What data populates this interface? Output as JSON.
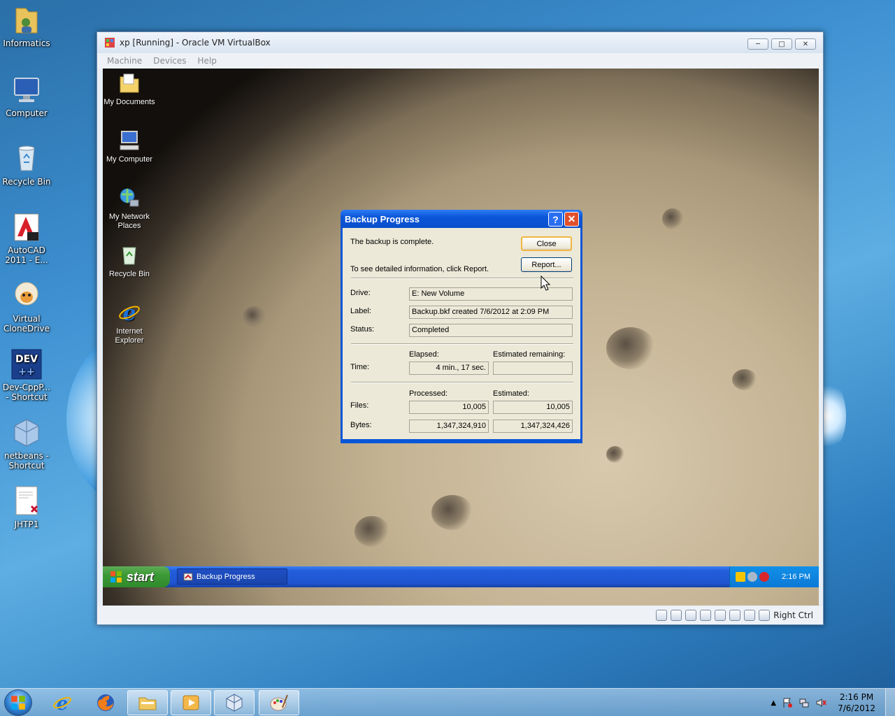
{
  "desktop_icons": [
    {
      "label": "Informatics",
      "icon": "folder-user-icon"
    },
    {
      "label": "Computer",
      "icon": "computer-icon"
    },
    {
      "label": "Recycle Bin",
      "icon": "recycle-bin-icon"
    },
    {
      "label": "AutoCAD 2011 - E...",
      "icon": "autocad-icon"
    },
    {
      "label": "Virtual CloneDrive",
      "icon": "sheep-icon"
    },
    {
      "label": "Dev-CppP... - Shortcut",
      "icon": "dev-cpp-icon"
    },
    {
      "label": "netbeans - Shortcut",
      "icon": "netbeans-icon"
    },
    {
      "label": "JHTP1",
      "icon": "pdf-document-icon"
    }
  ],
  "vbox": {
    "title": "xp [Running] - Oracle VM VirtualBox",
    "menu": [
      "Machine",
      "Devices",
      "Help"
    ],
    "host_key": "Right Ctrl"
  },
  "xp_icons": [
    {
      "label": "My Documents",
      "icon": "my-documents-icon"
    },
    {
      "label": "My Computer",
      "icon": "my-computer-icon"
    },
    {
      "label": "My Network Places",
      "icon": "network-places-icon"
    },
    {
      "label": "Recycle Bin",
      "icon": "recycle-bin-icon"
    },
    {
      "label": "Internet Explorer",
      "icon": "internet-explorer-icon"
    }
  ],
  "dialog": {
    "title": "Backup Progress",
    "help_glyph": "?",
    "message": "The backup is complete.",
    "info": "To see detailed information, click Report.",
    "close_label": "Close",
    "report_label": "Report...",
    "drive_label": "Drive:",
    "drive_value": "E: New Volume",
    "label_label": "Label:",
    "label_value": "Backup.bkf created 7/6/2012 at 2:09 PM",
    "status_label": "Status:",
    "status_value": "Completed",
    "elapsed_header": "Elapsed:",
    "remaining_header": "Estimated remaining:",
    "time_label": "Time:",
    "elapsed_value": "4 min., 17 sec.",
    "remaining_value": "",
    "processed_header": "Processed:",
    "estimated_header": "Estimated:",
    "files_label": "Files:",
    "files_processed": "10,005",
    "files_estimated": "10,005",
    "bytes_label": "Bytes:",
    "bytes_processed": "1,347,324,910",
    "bytes_estimated": "1,347,324,426"
  },
  "xp_taskbar": {
    "start_label": "start",
    "task_label": "Backup Progress",
    "clock": "2:16 PM"
  },
  "win7_taskbar": {
    "pinned": [
      "internet-explorer-icon",
      "firefox-icon",
      "explorer-folder-icon",
      "media-player-icon",
      "virtualbox-icon",
      "paint-icon"
    ],
    "time": "2:16 PM",
    "date": "7/6/2012"
  }
}
